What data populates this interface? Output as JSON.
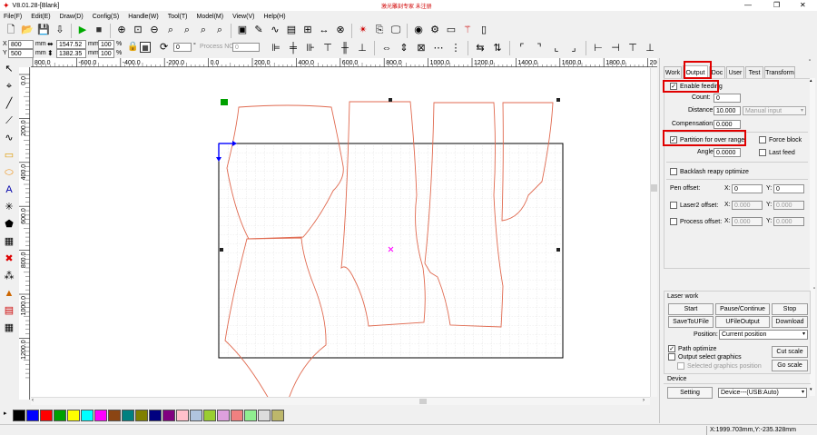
{
  "title_bar": {
    "title": "V8.01.28-[Blank]",
    "center_text": "激光雕刻专家  未注册",
    "minimize": "—",
    "maximize": "❐",
    "close": "✕"
  },
  "menu": [
    "File(F)",
    "Edit(E)",
    "Draw(D)",
    "Config(S)",
    "Handle(W)",
    "Tool(T)",
    "Model(M)",
    "View(V)",
    "Help(H)"
  ],
  "toolbar_main": [
    "new-file-icon",
    "open-folder-icon",
    "save-icon",
    "import-icon",
    "run-icon",
    "stop-icon",
    "zoom-in-icon",
    "zoom-window-icon",
    "zoom-out-icon",
    "zoom-select-icon",
    "zoom-page-icon",
    "zoom-all-icon",
    "zoom-fit-icon",
    "select-all-icon",
    "node-edit-icon",
    "curve-icon",
    "bitmap-icon",
    "array-icon",
    "measure-icon",
    "weld-icon",
    "laser-icon",
    "copy-icon",
    "monitor-icon",
    "camera-icon",
    "laser-head-icon",
    "vr-icon",
    "magic-wand-icon",
    "panel-icon"
  ],
  "coords": {
    "x_label": "X",
    "y_label": "Y",
    "x_val": "800",
    "y_val": "500",
    "mm": "mm",
    "w_val": "1547.52",
    "h_val": "1382.35",
    "w_unit": "mm",
    "h_unit": "mm",
    "w_pct": "100",
    "h_pct": "100",
    "pct": "%",
    "rotate_val": "0",
    "deg": "°",
    "process_label": "Process NO",
    "process_val": "0"
  },
  "toolbar_align": [
    "align-left-icon",
    "align-vcenter-icon",
    "align-right-icon",
    "align-top-icon",
    "align-hcenter-icon",
    "align-bottom-icon",
    "same-width-icon",
    "same-height-icon",
    "same-size-icon",
    "distribute-h-icon",
    "distribute-v-icon",
    "mirror-h-icon",
    "mirror-v-icon",
    "corner-tl-icon",
    "corner-tr-icon",
    "corner-bl-icon",
    "corner-br-icon",
    "edge-left-icon",
    "edge-right-icon",
    "edge-top-icon",
    "edge-bottom-icon"
  ],
  "ruler": {
    "h_ticks": [
      "800.0",
      "-600.0",
      "-400.0",
      "-200.0",
      "0.0",
      "200.0",
      "400.0",
      "600.0",
      "800.0",
      "1000.0",
      "1200.0",
      "1400.0",
      "1600.0",
      "1800.0",
      "2000.0"
    ],
    "v_ticks": [
      "0.0",
      "200.0",
      "400.0",
      "600.0",
      "800.0",
      "1000.0",
      "1200.0"
    ]
  },
  "left_tools": [
    "pointer-icon",
    "node-icon",
    "line-icon",
    "polyline-icon",
    "curve-tool-icon",
    "rectangle-icon",
    "ellipse-icon",
    "text-icon",
    "star-icon",
    "polygon-icon",
    "grid-icon",
    "delete-icon",
    "array-tool-icon",
    "weld-tool-icon",
    "output-tool-icon",
    "table-icon"
  ],
  "palette": [
    "#000000",
    "#0000ff",
    "#ff0000",
    "#00a000",
    "#ffff00",
    "#00ffff",
    "#ff00ff",
    "#8b4513",
    "#008080",
    "#808000",
    "#000080",
    "#800080",
    "#ffc0cb",
    "#b0c4de",
    "#9acd32",
    "#dda0dd",
    "#f08080",
    "#90ee90",
    "#dcdcdc",
    "#bdb76b"
  ],
  "colors": {
    "shape_stroke": "#e06a50",
    "table_border": "#000000",
    "highlight": "#e00000",
    "handle": "#222222",
    "origin_green": "#00a000",
    "axis_blue": "#0000ff",
    "center_mark": "#ff00ff"
  },
  "panel": {
    "tabs": [
      {
        "label": "Work",
        "active": false
      },
      {
        "label": "Output",
        "active": true
      },
      {
        "label": "Doc",
        "active": false
      },
      {
        "label": "User",
        "active": false
      },
      {
        "label": "Test",
        "active": false
      },
      {
        "label": "Transform",
        "active": false
      }
    ],
    "enable_feeding": {
      "label": "Enable feeding",
      "checked": true
    },
    "count": {
      "label": "Count:",
      "value": "0"
    },
    "distance": {
      "label": "Distance:",
      "value": "10.000",
      "mode": "Manual input"
    },
    "compensation": {
      "label": "Compensation:",
      "value": "0.000"
    },
    "partition": {
      "label": "Partition for over range",
      "checked": true
    },
    "force_block": {
      "label": "Force block",
      "checked": false
    },
    "angle": {
      "label": "Angle:",
      "value": "0.0000"
    },
    "last_feed": {
      "label": "Last feed",
      "checked": false
    },
    "backlash": {
      "label": "Backlash reapy optimize",
      "checked": false
    },
    "pen_offset": {
      "label": "Pen offset:",
      "x_label": "X:",
      "x": "0",
      "y_label": "Y:",
      "y": "0"
    },
    "laser2_offset": {
      "label": "Laser2 offset:",
      "checked": false,
      "x_label": "X:",
      "x": "0.000",
      "y_label": "Y:",
      "y": "0.000"
    },
    "process_offset": {
      "label": "Process offset:",
      "checked": false,
      "x_label": "X:",
      "x": "0.000",
      "y_label": "Y:",
      "y": "0.000"
    }
  },
  "laser_work": {
    "title": "Laser work",
    "buttons": {
      "start": "Start",
      "pause": "Pause/Continue",
      "stop": "Stop",
      "save_u": "SaveToUFile",
      "ufile_output": "UFileOutput",
      "download": "Download"
    },
    "position_label": "Position:",
    "position_value": "Current position",
    "path_optimize": {
      "label": "Path optimize",
      "checked": true
    },
    "output_select": {
      "label": "Output select graphics",
      "checked": false
    },
    "selected_pos": {
      "label": "Selected graphics position",
      "checked": false
    },
    "cut_scale": "Cut scale",
    "go_scale": "Go scale"
  },
  "device": {
    "title": "Device",
    "setting": "Setting",
    "value": "Device---(USB:Auto)"
  },
  "status": {
    "coords": "X:1999.703mm,Y:-235.328mm"
  }
}
